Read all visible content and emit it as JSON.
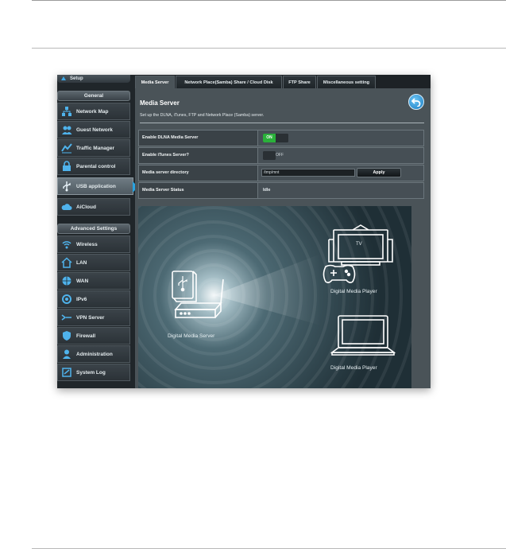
{
  "sidebar": {
    "top_label": "Setup",
    "general_header": "General",
    "general_items": [
      {
        "label": "Network Map",
        "icon": "network-map-icon"
      },
      {
        "label": "Guest Network",
        "icon": "guest-network-icon"
      },
      {
        "label": "Traffic Manager",
        "icon": "traffic-manager-icon"
      },
      {
        "label": "Parental control",
        "icon": "lock-icon"
      },
      {
        "label": "USB application",
        "icon": "usb-icon"
      },
      {
        "label": "AiCloud",
        "icon": "cloud-icon"
      }
    ],
    "advanced_header": "Advanced Settings",
    "advanced_items": [
      {
        "label": "Wireless",
        "icon": "wireless-icon"
      },
      {
        "label": "LAN",
        "icon": "home-icon"
      },
      {
        "label": "WAN",
        "icon": "globe-icon"
      },
      {
        "label": "IPv6",
        "icon": "ipv6-icon"
      },
      {
        "label": "VPN Server",
        "icon": "vpn-icon"
      },
      {
        "label": "Firewall",
        "icon": "shield-icon"
      },
      {
        "label": "Administration",
        "icon": "user-icon"
      },
      {
        "label": "System Log",
        "icon": "log-icon"
      }
    ],
    "active_item": "USB application"
  },
  "tabs": [
    "Media Server",
    "Network Place(Samba) Share / Cloud Disk",
    "FTP Share",
    "Miscellaneous setting"
  ],
  "panel": {
    "title": "Media Server",
    "description": "Set up the DLNA, iTunes, FTP and Network Place (Samba) server."
  },
  "settings": {
    "dlna_label": "Enable DLNA Media Server",
    "dlna_state": "ON",
    "itunes_label": "Enable iTunes Server?",
    "itunes_state": "OFF",
    "directory_label": "Media server directory",
    "directory_value": "/tmp/mnt",
    "apply_label": "Apply",
    "status_label": "Media Server Status",
    "status_value": "Idle"
  },
  "illustration": {
    "server_caption": "Digital Media Server",
    "player_caption_top": "Digital Media Player",
    "player_caption_bottom": "Digital Media Player",
    "tv_label": "TV"
  },
  "colors": {
    "accent_blue": "#2aa3e0",
    "toggle_on": "#2ab13a"
  }
}
